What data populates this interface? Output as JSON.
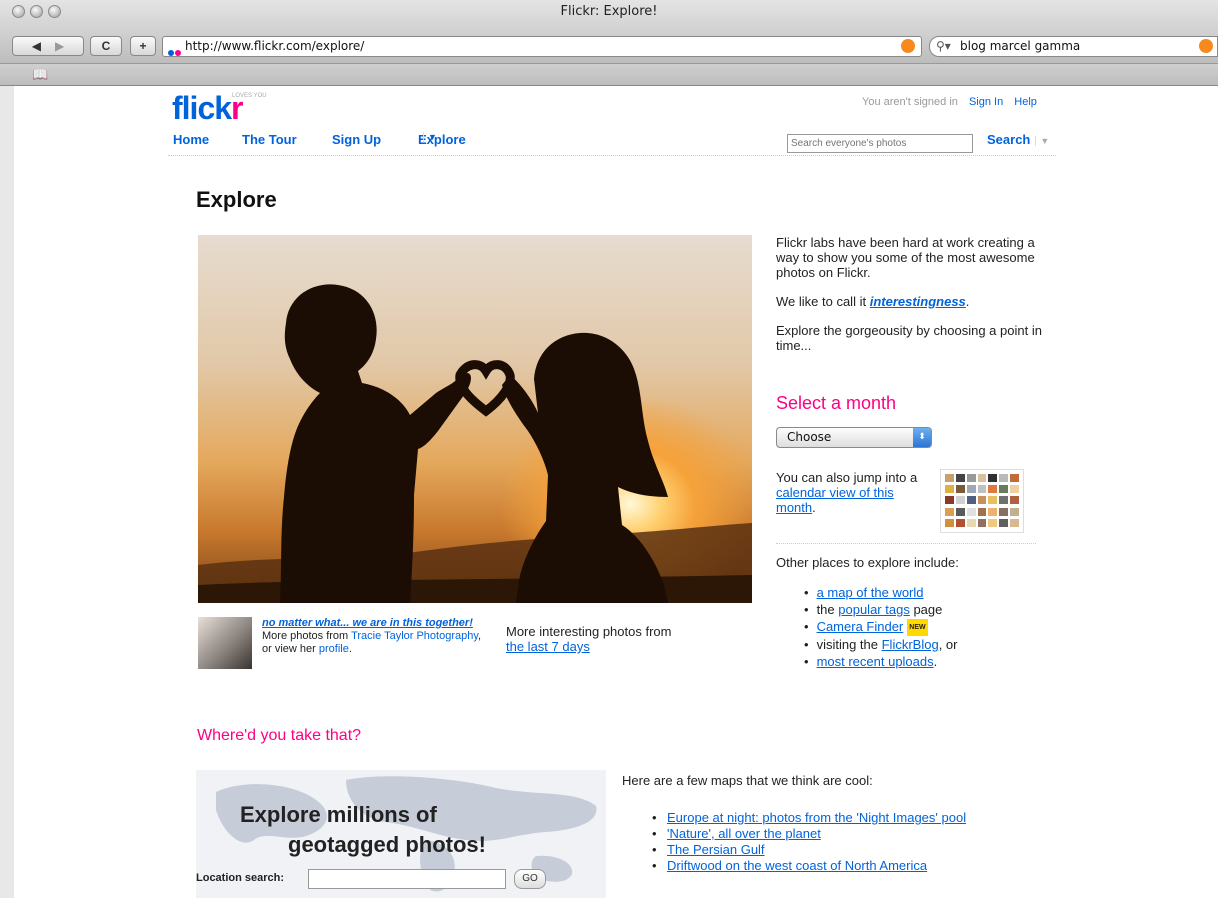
{
  "browser": {
    "window_title": "Flickr: Explore!",
    "url": "http://www.flickr.com/explore/",
    "search_value": "blog marcel gamma",
    "reload_label": "C",
    "add_label": "+"
  },
  "header": {
    "logo_blue": "flick",
    "logo_pink": "r",
    "logo_tag": "LOVES YOU",
    "signed_in_text": "You aren't signed in",
    "sign_in": "Sign In",
    "help": "Help",
    "nav": [
      "Home",
      "The Tour",
      "Sign Up",
      "Explore"
    ],
    "search_placeholder": "Search everyone's photos",
    "search_button": "Search"
  },
  "main": {
    "title": "Explore",
    "photo_title": "no matter what... we are in this together!",
    "photo_more_from": "More photos from",
    "photo_author": "Tracie Taylor Photography",
    "photo_or_view": ", or view her",
    "photo_profile": "profile",
    "more_interesting": "More interesting photos from",
    "last_7_days": "the last 7 days"
  },
  "sidebar": {
    "intro": "Flickr labs have been hard at work creating a way to show you some of the most awesome photos on Flickr.",
    "call_it_prefix": "We like to call it",
    "interestingness": "interestingness",
    "explore_text": "Explore the gorgeousity by choosing a point in time...",
    "select_month": "Select a month",
    "select_value": "Choose",
    "jump_prefix": "You can also jump into a",
    "calendar_link": "calendar view of this month",
    "other_places": "Other places to explore include:",
    "map_link": "a map of the world",
    "the": "the",
    "popular_tags": "popular tags",
    "page": "page",
    "camera_finder": "Camera Finder",
    "new_badge": "NEW",
    "visiting_the": "visiting the",
    "flickrblog": "FlickrBlog",
    "or": ", or",
    "recent_uploads": "most recent uploads"
  },
  "maps": {
    "heading": "Where'd you take that?",
    "banner_line1": "Explore millions of",
    "banner_line2": "geotagged photos!",
    "location_label": "Location search:",
    "go": "GO",
    "intro": "Here are a few maps that we think are cool:",
    "items": [
      "Europe at night: photos from the 'Night Images' pool",
      "'Nature', all over the planet",
      "The Persian Gulf",
      "Driftwood on the west coast of North America"
    ]
  },
  "colors": {
    "flickr_blue": "#0063dc",
    "flickr_pink": "#ff0084"
  }
}
